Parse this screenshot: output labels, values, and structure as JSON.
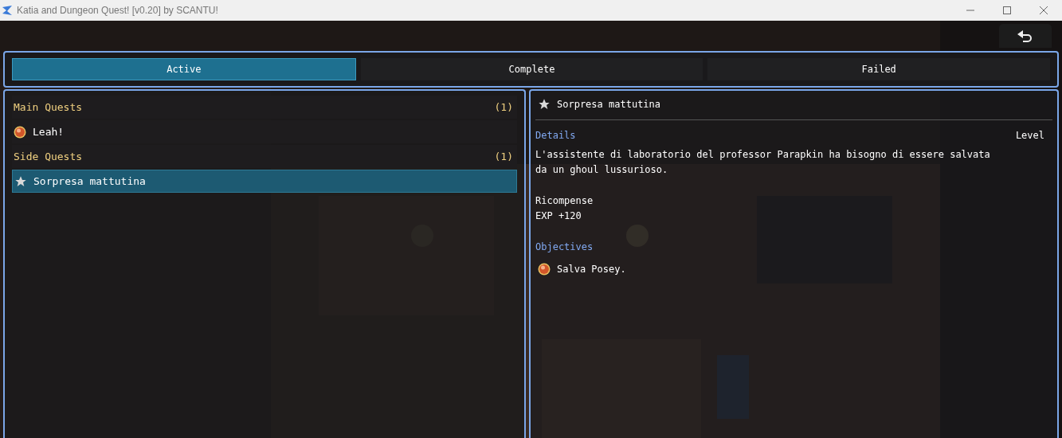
{
  "window": {
    "title": "Katia and Dungeon Quest! [v0.20] by SCANTU!"
  },
  "tabs": [
    {
      "label": "Active",
      "selected": true
    },
    {
      "label": "Complete",
      "selected": false
    },
    {
      "label": "Failed",
      "selected": false
    }
  ],
  "quest_list": [
    {
      "kind": "category",
      "label": "Main Quests",
      "count": "(1)"
    },
    {
      "kind": "main_quest",
      "label": "Leah!",
      "selected": false
    },
    {
      "kind": "category",
      "label": "Side Quests",
      "count": "(1)"
    },
    {
      "kind": "side_quest",
      "label": "Sorpresa mattutina",
      "selected": true
    }
  ],
  "detail": {
    "kind": "side_quest",
    "title": "Sorpresa mattutina",
    "details_heading": "Details",
    "level_label": "Level",
    "description": [
      "L'assistente di laboratorio del professor Parapkin ha bisogno di essere salvata",
      "da un ghoul lussurioso."
    ],
    "rewards_heading": "Ricompense",
    "rewards": [
      "EXP +120"
    ],
    "objectives_heading": "Objectives",
    "objectives": [
      {
        "label": "Salva Posey."
      }
    ]
  }
}
